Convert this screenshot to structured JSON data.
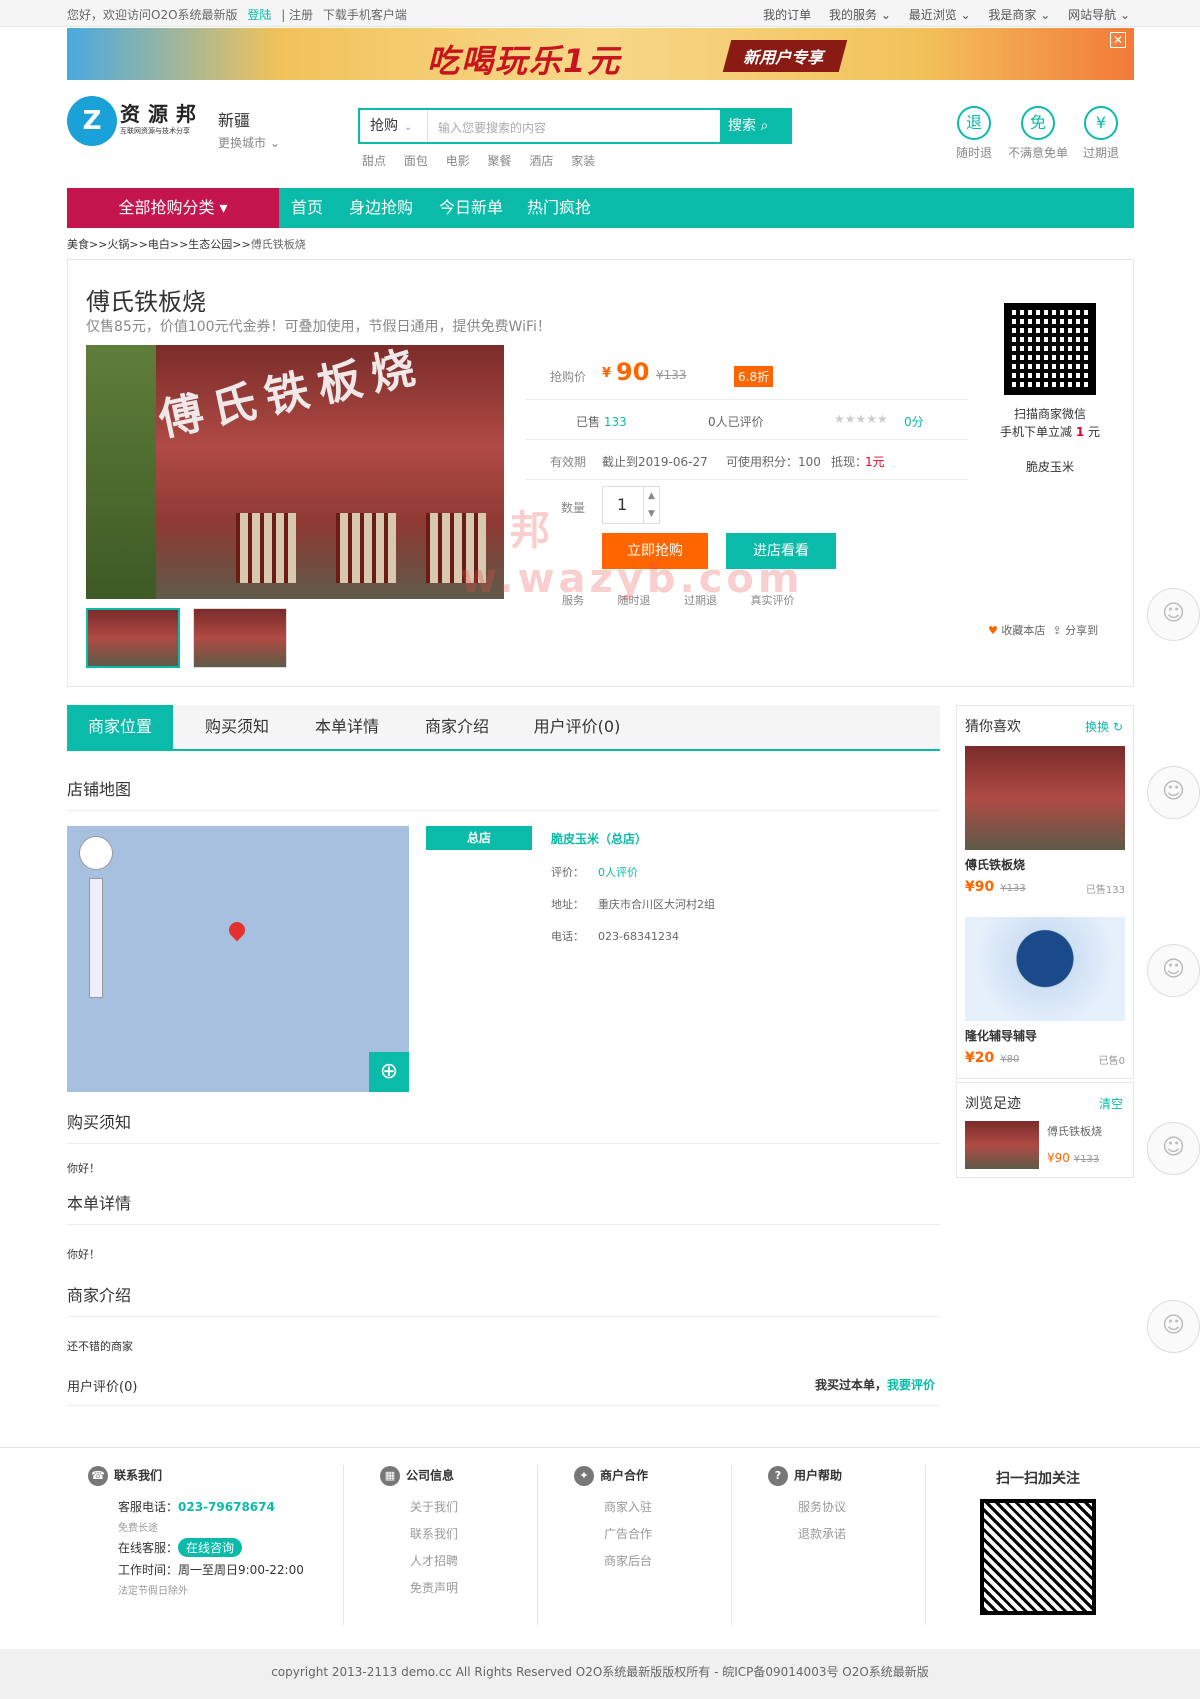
{
  "topbar": {
    "welcome": "您好，欢迎访问O2O系统最新版",
    "login": "登陆",
    "register": "| 注册",
    "download": "下载手机客户端",
    "links": [
      "我的订单",
      "我的服务 ⌄",
      "最近浏览 ⌄",
      "我是商家 ⌄",
      "网站导航 ⌄"
    ]
  },
  "banner": {
    "slogan": "吃喝玩乐1元",
    "tag": "新用户专享",
    "close": "✕"
  },
  "header": {
    "logo_glyph": "Z",
    "logo_text": "资源邦",
    "logo_sub": "互联网资源与技术分享",
    "city": "新疆",
    "change_city": "更换城市 ⌄",
    "search_type": "抢购",
    "search_placeholder": "输入您要搜索的内容",
    "search_button": "搜索",
    "hotwords": [
      "甜点",
      "面包",
      "电影",
      "聚餐",
      "酒店",
      "家装"
    ],
    "promises": [
      {
        "glyph": "退",
        "label": "随时退"
      },
      {
        "glyph": "免",
        "label": "不满意免单"
      },
      {
        "glyph": "¥",
        "label": "过期退"
      }
    ]
  },
  "nav": {
    "category": "全部抢购分类 ▾",
    "items": [
      "首页",
      "身边抢购",
      "今日新单",
      "热门疯抢"
    ]
  },
  "breadcrumb": {
    "path": "美食>>火锅>>电白>>生态公园>>",
    "current": "傅氏铁板烧"
  },
  "product": {
    "title": "傅氏铁板烧",
    "subtitle": "仅售85元，价值100元代金券！可叠加使用，节假日通用，提供免费WiFi！",
    "sign_text": "傅氏铁板烧",
    "price_label": "抢购价",
    "currency": "¥",
    "price": "90",
    "old_price": "¥133",
    "discount": "6.8折",
    "sold_label": "已售",
    "sold": "133",
    "reviews": "0人已评价",
    "stars": "★★★★★",
    "score": "0分",
    "validity_label": "有效期",
    "validity": "截止到2019-06-27",
    "points": "可使用积分：100",
    "deduct_label": "抵现：",
    "deduct": "1元",
    "qty_label": "数量",
    "qty": "1",
    "buy_button": "立即抢购",
    "shop_button": "进店看看",
    "service_label": "服务",
    "services": [
      "随时退",
      "过期退",
      "真实评价"
    ]
  },
  "qr_box": {
    "line1": "扫描商家微信",
    "line2_pre": "手机下单立减",
    "amount": "1",
    "line2_post": "元",
    "shop": "脆皮玉米"
  },
  "actions": {
    "fav": "收藏本店",
    "share": "分享到"
  },
  "tabs": [
    "商家位置",
    "购买须知",
    "本单详情",
    "商家介绍",
    "用户评价(0)"
  ],
  "sections": {
    "map_title": "店铺地图",
    "buy_notice_title": "购买须知",
    "buy_notice_text": "你好！",
    "detail_title": "本单详情",
    "detail_text": "你好！",
    "intro_title": "商家介绍",
    "intro_text": "还不错的商家",
    "review_title": "用户评价(0)",
    "review_cta": "我买过本单，",
    "review_link": "我要评价"
  },
  "branch": {
    "tag": "总店",
    "name": "脆皮玉米（总店）",
    "rating_label": "评价：",
    "rating": "0人评价",
    "address_label": "地址：",
    "address": "重庆市合川区大河村2组",
    "phone_label": "电话：",
    "phone": "023-68341234"
  },
  "sidebar": {
    "guess_title": "猜你喜欢",
    "refresh": "换换 ↻",
    "items": [
      {
        "name": "傅氏铁板烧",
        "price": "¥90",
        "old": "¥133",
        "sold": "已售133"
      },
      {
        "name": "隆化辅导辅导",
        "price": "¥20",
        "old": "¥80",
        "sold": "已售0"
      }
    ],
    "history_title": "浏览足迹",
    "clear": "清空",
    "history": {
      "name": "傅氏铁板烧",
      "price": "¥90",
      "old": "¥133"
    }
  },
  "footer": {
    "contact": {
      "title": "联系我们",
      "phone_label": "客服电话：",
      "phone": "023-79678674",
      "free": "免费长途",
      "online_label": "在线客服：",
      "online": "在线咨询",
      "hours": "工作时间：周一至周日9:00-22:00",
      "holiday": "法定节假日除外"
    },
    "cols": [
      {
        "title": "公司信息",
        "items": [
          "关于我们",
          "联系我们",
          "人才招聘",
          "免责声明"
        ]
      },
      {
        "title": "商户合作",
        "items": [
          "商家入驻",
          "广告合作",
          "商家后台"
        ]
      },
      {
        "title": "用户帮助",
        "items": [
          "服务协议",
          "退款承诺"
        ]
      }
    ],
    "follow": "扫一扫加关注",
    "copyright": "copyright 2013-2113 demo.cc All Rights Reserved O2O系统最新版版权所有 - 皖ICP备09014003号 O2O系统最新版"
  },
  "watermark": {
    "cn": "邦",
    "url": "w.wazyb.com"
  },
  "colors": {
    "accent": "#0bbbaa",
    "category": "#c5154e",
    "price": "#ff6600"
  }
}
